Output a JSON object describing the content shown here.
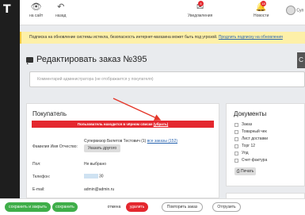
{
  "topbar": {
    "site_label": "на сайт",
    "back_label": "назад",
    "notifications_label": "Уведомления",
    "notifications_count": "4",
    "news_label": "Новости",
    "news_count": "18",
    "user_label": "Суп"
  },
  "notice": {
    "text": "Подписка на обновление системы истекла, безопасность интернет-магазина может быть под угрозой.",
    "link": "Продлить подписку на обновления"
  },
  "page": {
    "title": "Редактировать заказ №395",
    "comment_placeholder": "Комментарий администратора (не отображается у покупателя)",
    "corner_button": "С"
  },
  "buyer": {
    "heading": "Покупатель",
    "alert_text": "Пользователь находится в чёрном списке",
    "alert_link": "(убрать)",
    "name_label": "Фамилия Имя Отчество:",
    "name_value": "Супервизор Билетов Тестович (1)",
    "orders_link": "все заказы (152)",
    "change_button": "Указать другого",
    "sex_label": "Пол:",
    "sex_value": "Не выбрано",
    "phone_label": "Телефон:",
    "phone_value": "30",
    "email_label": "E-mail:",
    "email_value": "admin@admin.ru"
  },
  "documents": {
    "heading": "Документы",
    "items": [
      "Заказ",
      "Товарный чек",
      "Лист доставки",
      "Торг 12",
      "Упд",
      "Счет-фактура"
    ],
    "print_button": "Печать"
  },
  "bottombar": {
    "save_close": "сохранить и закрыть",
    "save": "сохранить",
    "cancel": "отмена",
    "delete": "удалить",
    "repeat": "Повторить заказ",
    "ship": "Отгрузить"
  }
}
